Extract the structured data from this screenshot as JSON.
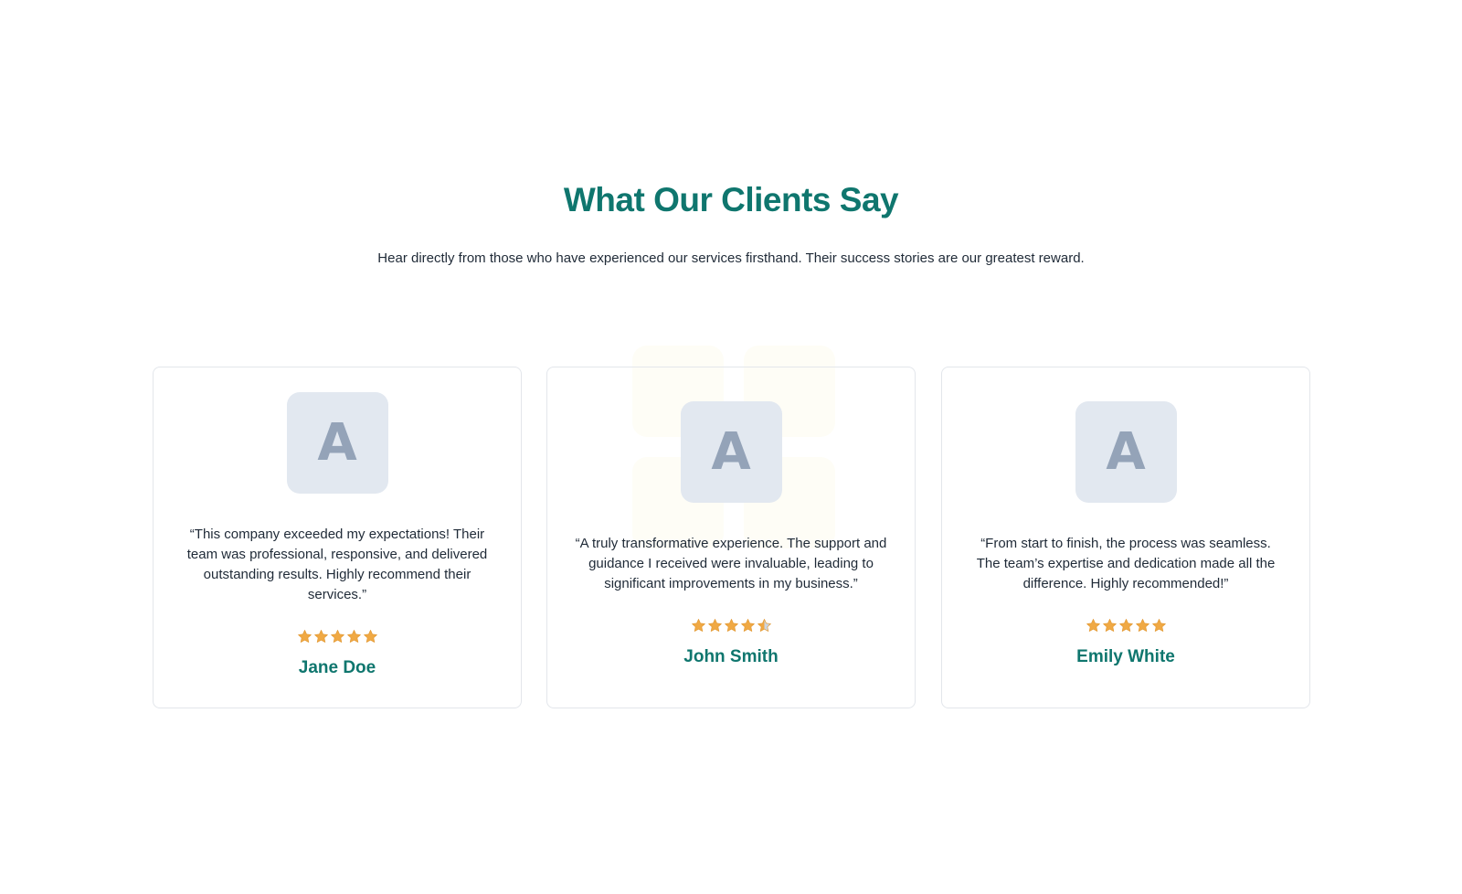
{
  "section": {
    "title": "What Our Clients Say",
    "subtitle": "Hear directly from those who have experienced our services firsthand. Their success stories are our greatest reward."
  },
  "colors": {
    "accent": "#0f766e",
    "star": "#f0a944",
    "star_empty": "#cbd5e1",
    "avatar_bg": "#e2e8f0",
    "avatar_text": "#94a3b8"
  },
  "testimonials": [
    {
      "avatar_initial": "A",
      "quote": "“This company exceeded my expectations! Their team was professional, responsive, and delivered outstanding results. Highly recommend their services.”",
      "rating": 5,
      "rating_max": 5,
      "name": "Jane Doe"
    },
    {
      "avatar_initial": "A",
      "quote": "“A truly transformative experience. The support and guidance I received were invaluable, leading to significant improvements in my business.”",
      "rating": 4.5,
      "rating_max": 5,
      "name": "John Smith"
    },
    {
      "avatar_initial": "A",
      "quote": "“From start to finish, the process was seamless. The team’s expertise and dedication made all the difference. Highly recommended!”",
      "rating": 5,
      "rating_max": 5,
      "name": "Emily White"
    }
  ]
}
